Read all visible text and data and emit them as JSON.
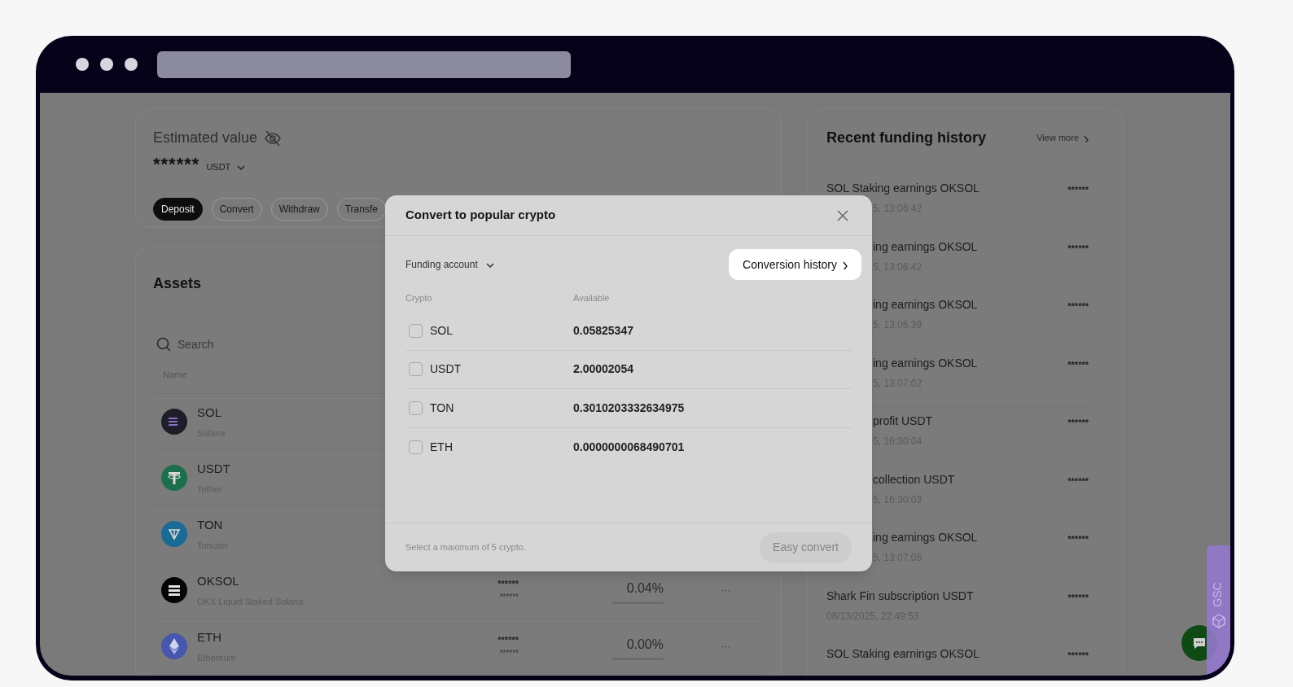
{
  "balance": {
    "label": "Estimated value",
    "value": "******",
    "currency": "USDT",
    "actions": [
      {
        "label": "Deposit",
        "primary": true
      },
      {
        "label": "Convert",
        "primary": false
      },
      {
        "label": "Withdraw",
        "primary": false
      },
      {
        "label": "Transfe",
        "primary": false
      }
    ]
  },
  "assets": {
    "title": "Assets",
    "search_placeholder": "Search",
    "columns": [
      "Name"
    ],
    "rows": [
      {
        "kind": "solana",
        "color": "#1e1e28",
        "symbol": "SOL",
        "name": "Solana"
      },
      {
        "kind": "tether",
        "color": "#1d6e4d",
        "symbol": "USDT",
        "name": "Tether"
      },
      {
        "kind": "ton",
        "color": "#1a6a96",
        "symbol": "TON",
        "name": "Toncoin"
      },
      {
        "kind": "oksol",
        "color": "#050505",
        "symbol": "OKSOL",
        "name": "OKX Liquid Staked Solana",
        "balance": "******",
        "balance_sub": "******",
        "rate": "0.04%",
        "menu": "···"
      },
      {
        "kind": "ether",
        "color": "#4657ad",
        "symbol": "ETH",
        "name": "Ethereum",
        "balance": "******",
        "balance_sub": "******",
        "rate": "0.00%",
        "menu": "···"
      }
    ]
  },
  "funding_history": {
    "title": "Recent funding history",
    "view_more": "View more",
    "items": [
      {
        "title": "SOL Staking earnings OKSOL",
        "date": "5, 13:06:42",
        "amount": "******",
        "title_clipped": false,
        "date_clipped": true
      },
      {
        "title": "ing earnings OKSOL",
        "date": "5, 13:06:42",
        "amount": "******",
        "title_clipped": true,
        "date_clipped": true
      },
      {
        "title": "ing earnings OKSOL",
        "date": "5, 13:06:39",
        "amount": "******",
        "title_clipped": true,
        "date_clipped": true
      },
      {
        "title": "ing earnings OKSOL",
        "date": "5, 13:07:02",
        "amount": "******",
        "title_clipped": true,
        "date_clipped": true
      },
      {
        "title": "profit USDT",
        "date": "5, 16:30:04",
        "amount": "******",
        "title_clipped": true,
        "date_clipped": true
      },
      {
        "title": "collection USDT",
        "date": "5, 16:30:03",
        "amount": "******",
        "title_clipped": true,
        "date_clipped": true
      },
      {
        "title": "ing earnings OKSOL",
        "date": "5, 13:07:05",
        "amount": "******",
        "title_clipped": true,
        "date_clipped": true
      },
      {
        "title": "Shark Fin subscription USDT",
        "date": "06/13/2025, 22:49:53",
        "amount": "******"
      },
      {
        "title": "SOL Staking earnings OKSOL",
        "amount": "******"
      }
    ]
  },
  "dialog": {
    "title": "Convert to popular crypto",
    "account": "Funding account",
    "history_button": "Conversion history",
    "columns": [
      "Crypto",
      "Available"
    ],
    "rows": [
      {
        "symbol": "SOL",
        "available": "0.05825347",
        "checked": false
      },
      {
        "symbol": "USDT",
        "available": "2.00002054",
        "checked": false
      },
      {
        "symbol": "TON",
        "available": "0.3010203332634975",
        "checked": false
      },
      {
        "symbol": "ETH",
        "available": "0.0000000068490701",
        "checked": false
      }
    ],
    "hint": "Select a maximum of 5 crypto.",
    "convert_button": {
      "label": "Easy convert",
      "disabled": true
    }
  },
  "side_tab": {
    "label": "GSC"
  }
}
